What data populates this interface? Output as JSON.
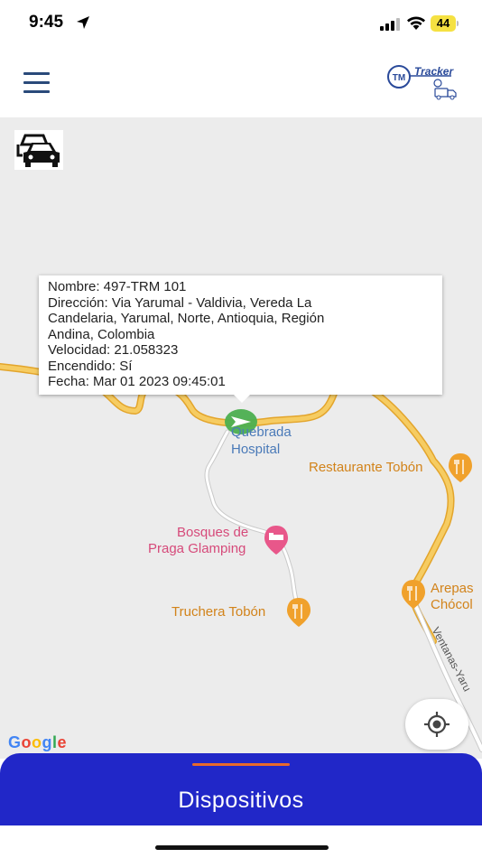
{
  "status_bar": {
    "time": "9:45",
    "battery": "44",
    "icons": [
      "location-arrow-icon",
      "signal-icon",
      "wifi-icon",
      "battery-icon"
    ]
  },
  "header": {
    "logo_text": "Tracker",
    "logo_badge": "TM",
    "icons": [
      "menu-icon",
      "tracker-logo"
    ]
  },
  "map": {
    "vehicles_button_icon": "cars-icon",
    "popup": {
      "nombre": "Nombre: 497-TRM 101",
      "direccion_1": "Dirección: Via Yarumal - Valdivia, Vereda La",
      "direccion_2": "Candelaria, Yarumal, Norte, Antioquia, Región",
      "direccion_3": "Andina, Colombia",
      "velocidad": "Velocidad: 21.058323",
      "encendido": "Encendido: Sí",
      "fecha": "Fecha:  Mar 01 2023 09:45:01"
    },
    "places": {
      "quebrada_1": "Quebrada",
      "quebrada_2": "Hospital",
      "restaurante": "Restaurante Tobón",
      "bosques_1": "Bosques de",
      "bosques_2": "Praga Glamping",
      "truchera": "Truchera Tobón",
      "arepas_1": "Arepas",
      "arepas_2": "Chócol",
      "road": "Ventanas-Yaru"
    },
    "google": "Google",
    "colors": {
      "road": "#f3c252",
      "road_edge": "#e3a52c",
      "marker": "#4caf50",
      "poi_orange": "#d2831a",
      "poi_pink": "#d64a7a"
    }
  },
  "bottom_panel": {
    "title": "Dispositivos",
    "color": "#2127c8"
  }
}
